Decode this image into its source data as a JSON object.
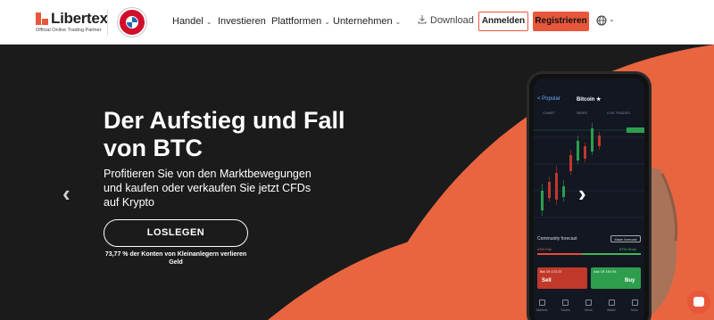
{
  "header": {
    "logo_text": "Libertex",
    "logo_sub": "Official Online Trading Partner",
    "nav": [
      {
        "label": "Handel",
        "has_dropdown": true
      },
      {
        "label": "Investieren",
        "has_dropdown": false
      },
      {
        "label": "Plattformen",
        "has_dropdown": true
      },
      {
        "label": "Unternehmen",
        "has_dropdown": true
      }
    ],
    "download_label": "Download",
    "login_label": "Anmelden",
    "register_label": "Registrieren",
    "icons": {
      "globe": "globe-icon",
      "download": "download-icon",
      "dropdown": "chevron-down-icon"
    }
  },
  "hero": {
    "title": "Der Aufstieg und Fall von BTC",
    "subtitle": "Profitieren Sie von den Marktbewegungen und kaufen oder verkaufen Sie jetzt CFDs auf Krypto",
    "cta_label": "LOSLEGEN",
    "risk_warning": "73,77 % der Konten von Kleinanlegern verlieren Geld",
    "arrow_prev": "‹",
    "arrow_next": "›"
  },
  "phone": {
    "back": "< Popular",
    "title": "Bitcoin ★",
    "tabs": [
      "CHART",
      "NEWS",
      "LIVE TRADES"
    ],
    "forecast_title": "Community forecast",
    "forecast_button": "Make forecast",
    "fall_label": "43% Fall",
    "grow_label": "57% Grow",
    "fall_fraction": 0.43,
    "sell_label": "Sell",
    "buy_label": "Buy",
    "sell_price": "Bid 19 172.07",
    "buy_price": "Ask 19 192.94",
    "nav": [
      "Markets",
      "Trades",
      "News",
      "Wallet",
      "More"
    ]
  },
  "colors": {
    "accent": "#e8573b",
    "hero_bg": "#1b1b1b",
    "sell": "#c0392b",
    "buy": "#2e9e4d"
  }
}
